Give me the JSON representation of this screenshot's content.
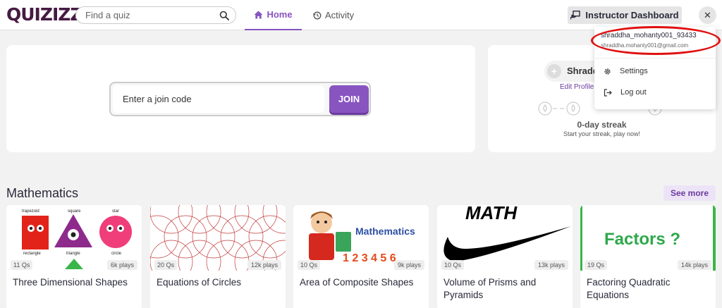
{
  "header": {
    "logo": "QUIZIZZ",
    "search_placeholder": "Find a quiz",
    "tabs": [
      {
        "label": "Home",
        "icon": "home-icon",
        "active": true
      },
      {
        "label": "Activity",
        "icon": "history-icon",
        "active": false
      }
    ],
    "instructor_button": "Instructor Dashboard",
    "close_label": "✕"
  },
  "join": {
    "placeholder": "Enter a join code",
    "button": "JOIN"
  },
  "profile": {
    "name": "Shradd",
    "edit": "Edit Profile",
    "streak": "0-day streak",
    "streak_sub": "Start your streak, play now!"
  },
  "dropdown": {
    "username": "shraddha_mohanty001_93433",
    "email": "shraddha.mohanty001@gmail.com",
    "settings": "Settings",
    "logout": "Log out"
  },
  "section": {
    "title": "Mathematics",
    "see_more": "See more"
  },
  "quizzes": [
    {
      "title": "Three Dimensional Shapes",
      "questions": "11 Qs",
      "plays": "6k plays"
    },
    {
      "title": "Equations of Circles",
      "questions": "20 Qs",
      "plays": "12k plays"
    },
    {
      "title": "Area of Composite Shapes",
      "questions": "10 Qs",
      "plays": "9k plays"
    },
    {
      "title": "Volume of Prisms and Pyramids",
      "questions": "10 Qs",
      "plays": "13k plays"
    },
    {
      "title": "Factoring Quadratic Equations",
      "questions": "19 Qs",
      "plays": "14k plays"
    }
  ],
  "thumb_text": {
    "shapes_labels": [
      "trapezoid",
      "square",
      "star",
      "rectangle",
      "triangle",
      "circle"
    ],
    "math_banner": "Mathematics",
    "math_logo": "MATH",
    "factors": "Factors ?"
  },
  "colors": {
    "brand": "#8854c0",
    "logo": "#461a42",
    "highlight": "#e01010"
  }
}
